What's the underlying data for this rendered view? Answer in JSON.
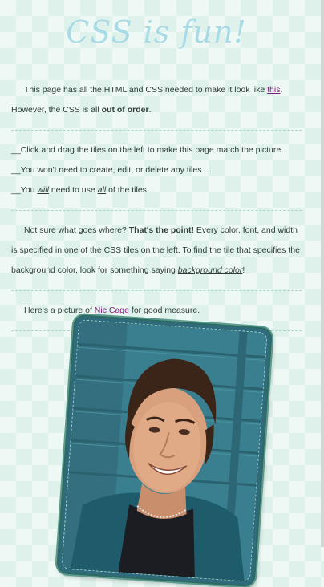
{
  "page": {
    "title": "CSS is fun!",
    "intro": {
      "part1": "This page has all the HTML and CSS needed to make it look like ",
      "link": "this",
      "part2": ". However, the CSS is all ",
      "bold": "out of order",
      "part3": "."
    },
    "tasks": [
      {
        "prefix": "__",
        "text": "Click and drag the tiles on the left to make this page match the picture..."
      },
      {
        "prefix": "__",
        "text": "You won't need to create, edit, or delete any tiles..."
      },
      {
        "prefix": "__",
        "pre": "You ",
        "em1": "will",
        "mid": " need to use ",
        "em2": "all",
        "post": " of the tiles..."
      }
    ],
    "note": {
      "part1": "Not sure what goes where? ",
      "bold": "That's the point!",
      "part2": " Every color, font, and width is specified in one of the CSS tiles on the left. To find the tile that specifies the background color, look for something saying ",
      "em": "background color",
      "part3": "!"
    },
    "picture_line": {
      "part1": "Here's a picture of ",
      "link": "Nic Cage",
      "part2": " for good measure."
    }
  },
  "colors": {
    "title": "#a9dbe6",
    "background": "#eef9f5",
    "link": "#7a1f7a",
    "divider": "#a9d9cc",
    "photo_border": "#2e6a61"
  }
}
